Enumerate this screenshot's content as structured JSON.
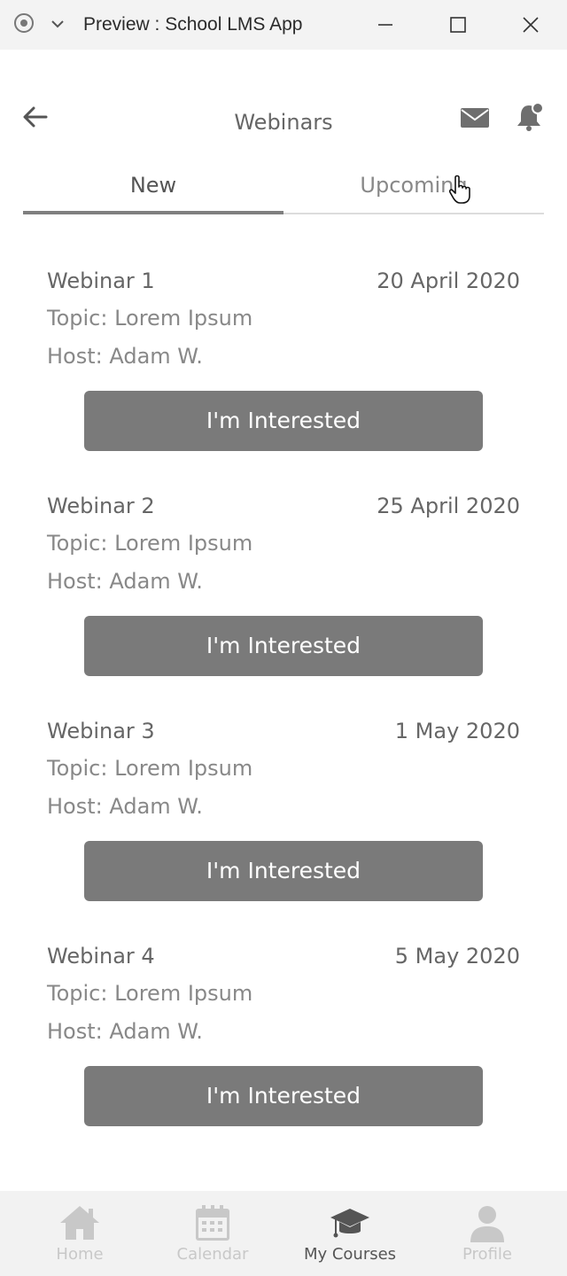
{
  "window": {
    "title": "Preview : School LMS App"
  },
  "header": {
    "title": "Webinars"
  },
  "tabs": [
    {
      "label": "New",
      "active": true
    },
    {
      "label": "Upcoming",
      "active": false
    }
  ],
  "webinars": [
    {
      "title": "Webinar 1",
      "date": "20 April 2020",
      "topic": "Topic: Lorem Ipsum",
      "host": "Host: Adam W.",
      "button": "I'm Interested"
    },
    {
      "title": "Webinar 2",
      "date": "25 April 2020",
      "topic": "Topic: Lorem Ipsum",
      "host": "Host: Adam W.",
      "button": "I'm Interested"
    },
    {
      "title": "Webinar 3",
      "date": "1 May 2020",
      "topic": "Topic: Lorem Ipsum",
      "host": "Host: Adam W.",
      "button": "I'm Interested"
    },
    {
      "title": "Webinar 4",
      "date": "5 May 2020",
      "topic": "Topic: Lorem Ipsum",
      "host": "Host: Adam W.",
      "button": "I'm Interested"
    }
  ],
  "nav": [
    {
      "label": "Home",
      "icon": "home-icon",
      "active": false
    },
    {
      "label": "Calendar",
      "icon": "calendar-icon",
      "active": false
    },
    {
      "label": "My Courses",
      "icon": "graduation-cap-icon",
      "active": true
    },
    {
      "label": "Profile",
      "icon": "user-icon",
      "active": false
    }
  ],
  "colors": {
    "button": "#7a7a7a",
    "nav_inactive": "#c8c8c8",
    "nav_active": "#555555"
  }
}
